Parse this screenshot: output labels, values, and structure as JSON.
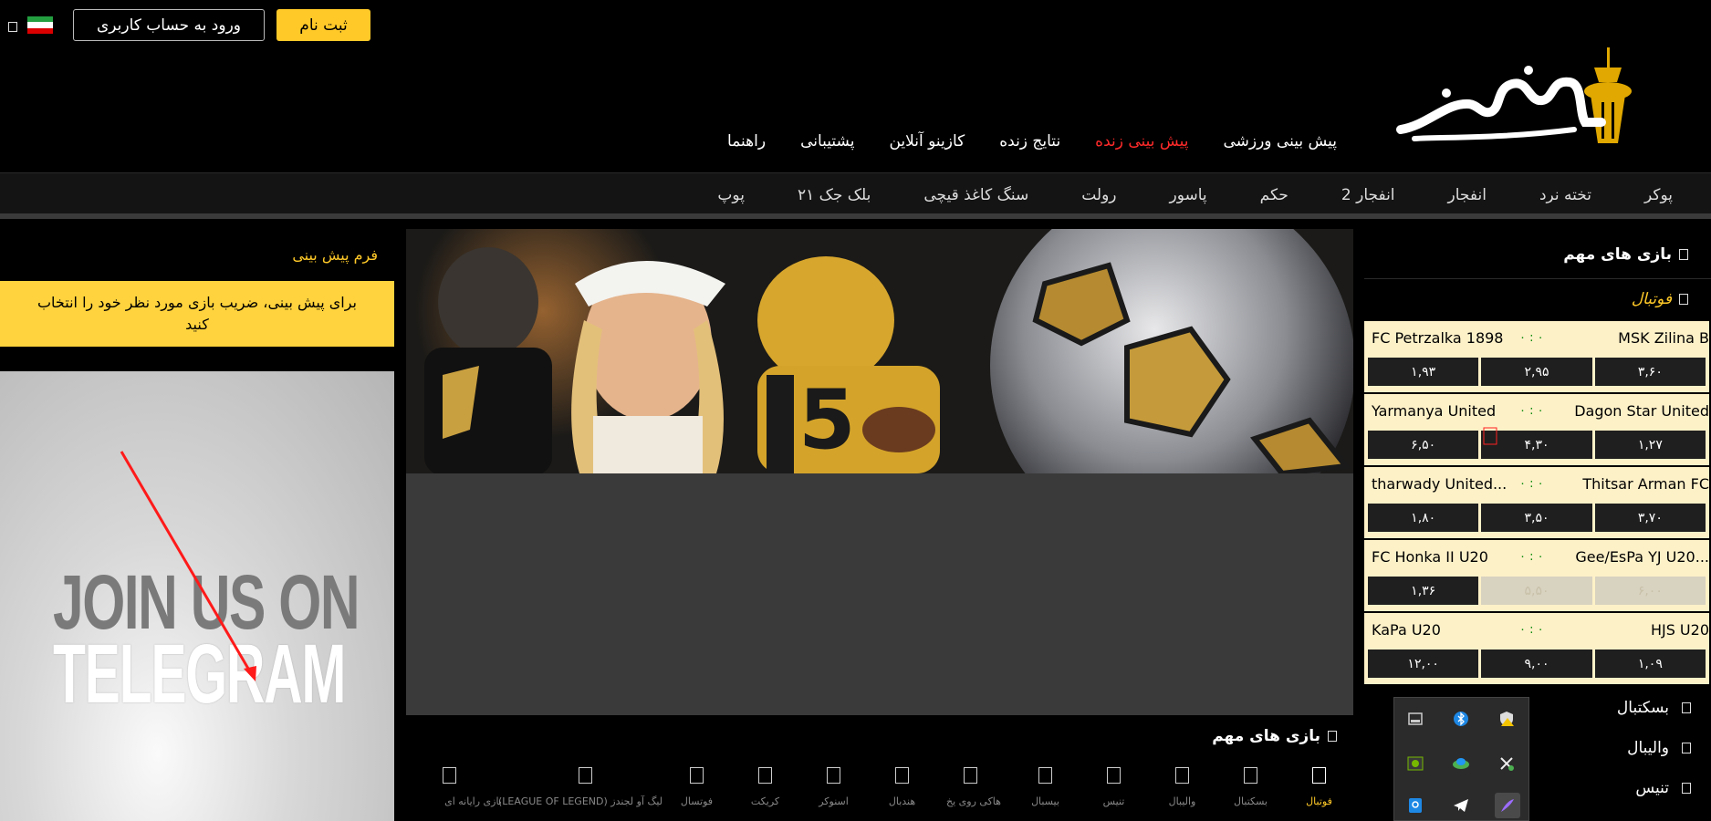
{
  "header": {
    "register_label": "ثبت نام",
    "login_label": "ورود به حساب کاربری",
    "main_nav": [
      {
        "label": "پیش بینی ورزشی",
        "active": false
      },
      {
        "label": "پیش بینی زنده",
        "active": true
      },
      {
        "label": "نتایج زنده",
        "active": false
      },
      {
        "label": "کازینو آنلاین",
        "active": false
      },
      {
        "label": "پشتیبانی",
        "active": false
      },
      {
        "label": "راهنما",
        "active": false
      }
    ]
  },
  "games_nav": [
    "پوکر",
    "تخته نرد",
    "انفجار",
    "انفجار 2",
    "حکم",
    "پاسور",
    "رولت",
    "سنگ کاغذ قیچی",
    "بلک جک ۲۱",
    "پوپ"
  ],
  "left_panel": {
    "title": "فرم پیش بینی",
    "instruction": "برای پیش بینی، ضریب بازی مورد نظر خود را انتخاب کنید",
    "promo_line1": "JOIN US ON",
    "promo_line2": "TELEGRAM"
  },
  "center": {
    "important_title": "بازی های مهم",
    "sport_tabs": [
      {
        "label": "فوتبال",
        "active": true
      },
      {
        "label": "بسکتبال",
        "active": false
      },
      {
        "label": "والیبال",
        "active": false
      },
      {
        "label": "تنیس",
        "active": false
      },
      {
        "label": "بیسبال",
        "active": false
      },
      {
        "label": "هاکی روی یخ",
        "active": false
      },
      {
        "label": "هندبال",
        "active": false
      },
      {
        "label": "اسنوکر",
        "active": false
      },
      {
        "label": "کریکت",
        "active": false
      },
      {
        "label": "فوتسال",
        "active": false
      },
      {
        "label": "لیگ آو لجندز (LEAGUE OF LEGEND)",
        "active": false
      },
      {
        "label": "بازی رایانه ای",
        "active": false
      }
    ]
  },
  "right_panel": {
    "important_title": "بازی های مهم",
    "category": "فوتبال",
    "matches": [
      {
        "home": "MSK Zilina B",
        "away": "FC Petrzalka 1898",
        "score": "۰ : ۰",
        "odds": [
          "۳,۶۰",
          "۲,۹۵",
          "۱,۹۳"
        ],
        "disabled": [
          false,
          false,
          false
        ]
      },
      {
        "home": "Dagon Star United",
        "away": "Yarmanya United",
        "score": "۰ : ۰",
        "odds": [
          "۱,۲۷",
          "۴,۳۰",
          "۶,۵۰"
        ],
        "disabled": [
          false,
          false,
          false
        ]
      },
      {
        "home": "Thitsar Arman FC",
        "away": "tharwady United...",
        "score": "۰ : ۰",
        "odds": [
          "۳,۷۰",
          "۳,۵۰",
          "۱,۸۰"
        ],
        "disabled": [
          false,
          false,
          false
        ]
      },
      {
        "home": "Gee/EsPa YJ U20...",
        "away": "FC Honka II U20",
        "score": "۰ : ۰",
        "odds": [
          "۶,۰۰",
          "۵,۵۰",
          "۱,۳۶"
        ],
        "disabled": [
          true,
          true,
          false
        ]
      },
      {
        "home": "HJS U20",
        "away": "KaPa U20",
        "score": "۰ : ۰",
        "odds": [
          "۱,۰۹",
          "۹,۰۰",
          "۱۲,۰۰"
        ],
        "disabled": [
          false,
          false,
          false
        ]
      }
    ],
    "sports": [
      "بسکتبال",
      "والیبال",
      "تنیس"
    ]
  },
  "colors": {
    "accent": "#ffc928",
    "active_nav": "#ff2a2a",
    "match_bg": "#fdf1c8"
  },
  "tray_icons": [
    "security-warning-icon",
    "bluetooth-icon",
    "drive-icon",
    "snipping-tool-icon",
    "network-icon",
    "nvidia-icon",
    "pen-icon",
    "telegram-icon",
    "search-app-icon"
  ]
}
